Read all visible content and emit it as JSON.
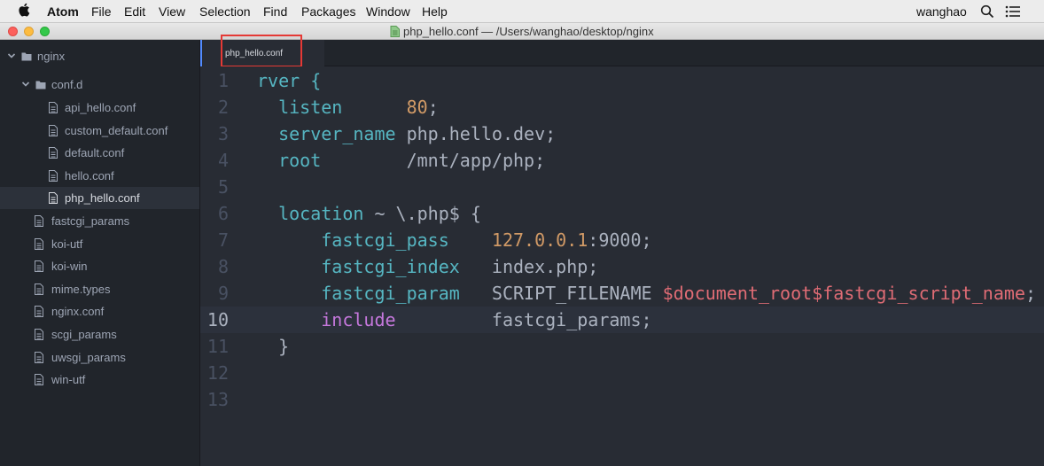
{
  "menubar": {
    "app_name": "Atom",
    "items": [
      "File",
      "Edit",
      "View",
      "Selection",
      "Find",
      "Packages",
      "Window",
      "Help"
    ],
    "user": "wanghao"
  },
  "window": {
    "title": "php_hello.conf — /Users/wanghao/desktop/nginx"
  },
  "tree": {
    "root": "nginx",
    "folder": "conf.d",
    "conf_d_files": [
      "api_hello.conf",
      "custom_default.conf",
      "default.conf",
      "hello.conf",
      "php_hello.conf"
    ],
    "files": [
      "fastcgi_params",
      "koi-utf",
      "koi-win",
      "mime.types",
      "nginx.conf",
      "scgi_params",
      "uwsgi_params",
      "win-utf"
    ],
    "selected": "php_hello.conf"
  },
  "tab": {
    "label": "php_hello.conf"
  },
  "editor": {
    "current_line": 10,
    "gutter": [
      "1",
      "2",
      "3",
      "4",
      "5",
      "6",
      "7",
      "8",
      "9",
      "10",
      "11",
      "12",
      "13"
    ],
    "lines": [
      [
        {
          "t": "rver {",
          "c": "kw"
        }
      ],
      [
        {
          "t": "  ",
          "c": "txt"
        },
        {
          "t": "listen",
          "c": "kw"
        },
        {
          "t": "      ",
          "c": "txt"
        },
        {
          "t": "80",
          "c": "num"
        },
        {
          "t": ";",
          "c": "txt"
        }
      ],
      [
        {
          "t": "  ",
          "c": "txt"
        },
        {
          "t": "server_name",
          "c": "kw"
        },
        {
          "t": " php.hello.dev;",
          "c": "txt"
        }
      ],
      [
        {
          "t": "  ",
          "c": "txt"
        },
        {
          "t": "root",
          "c": "kw"
        },
        {
          "t": "        /mnt/app/php;",
          "c": "txt"
        }
      ],
      [],
      [
        {
          "t": "  ",
          "c": "txt"
        },
        {
          "t": "location",
          "c": "kw"
        },
        {
          "t": " ~ \\.php$ {",
          "c": "txt"
        }
      ],
      [
        {
          "t": "      ",
          "c": "txt"
        },
        {
          "t": "fastcgi_pass",
          "c": "kw"
        },
        {
          "t": "    ",
          "c": "txt"
        },
        {
          "t": "127.0.0.1",
          "c": "num"
        },
        {
          "t": ":9000;",
          "c": "txt"
        }
      ],
      [
        {
          "t": "      ",
          "c": "txt"
        },
        {
          "t": "fastcgi_index",
          "c": "kw"
        },
        {
          "t": "   index.php;",
          "c": "txt"
        }
      ],
      [
        {
          "t": "      ",
          "c": "txt"
        },
        {
          "t": "fastcgi_param",
          "c": "kw"
        },
        {
          "t": "   SCRIPT_FILENAME ",
          "c": "txt"
        },
        {
          "t": "$document_root$fastcgi_script_name",
          "c": "var"
        },
        {
          "t": ";",
          "c": "txt"
        }
      ],
      [
        {
          "t": "      ",
          "c": "txt"
        },
        {
          "t": "include",
          "c": "inc"
        },
        {
          "t": "         fastcgi_params;",
          "c": "txt"
        }
      ],
      [
        {
          "t": "  }",
          "c": "txt"
        }
      ],
      [],
      []
    ]
  },
  "colors": {
    "keyword": "#56b6c2",
    "number": "#d19a66",
    "variable": "#e06c75",
    "include": "#c678dd",
    "text": "#abb2bf",
    "tab_highlight": "#e53935"
  }
}
